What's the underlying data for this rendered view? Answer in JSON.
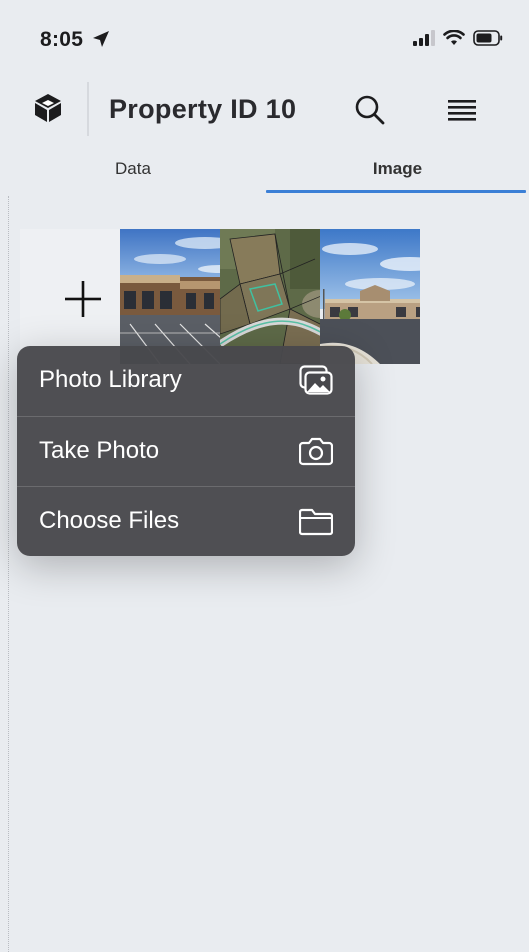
{
  "status_bar": {
    "time": "8:05"
  },
  "header": {
    "title": "Property ID 10"
  },
  "tabs": [
    {
      "label": "Data"
    },
    {
      "label": "Image"
    }
  ],
  "gallery": {
    "add_label": "+"
  },
  "popup_menu": {
    "items": [
      {
        "label": "Photo Library",
        "icon": "photo-library-icon"
      },
      {
        "label": "Take Photo",
        "icon": "camera-icon"
      },
      {
        "label": "Choose Files",
        "icon": "folder-icon"
      }
    ]
  },
  "colors": {
    "accent": "#3b7fd6",
    "menu_bg": "#48484c",
    "background": "#e9ecf0"
  }
}
